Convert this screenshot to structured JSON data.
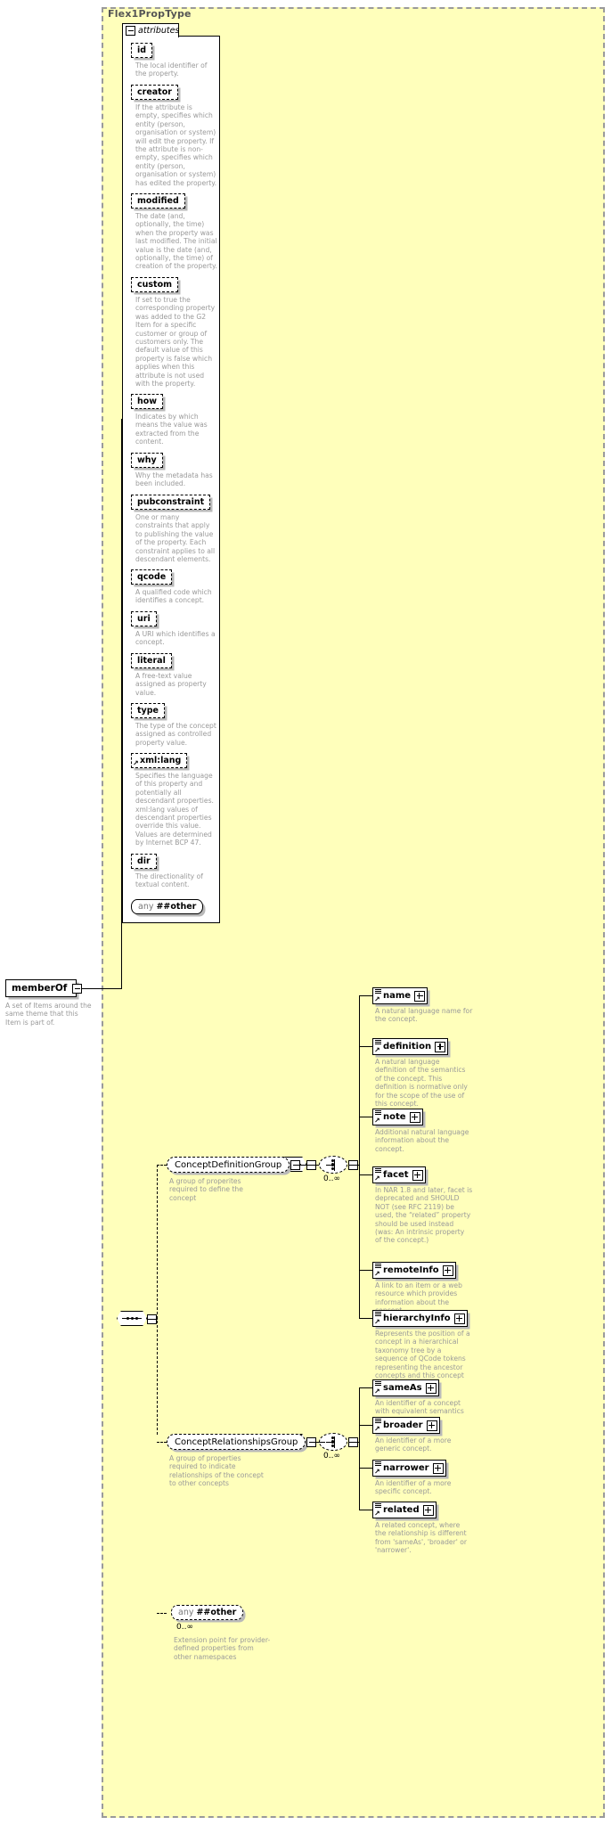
{
  "diagram": {
    "type_name": "Flex1PropType",
    "attributes_tab_label": "attributes",
    "root_element": {
      "name": "memberOf",
      "description": "A set of Items around the same theme that this Item is part of."
    },
    "colors": {
      "panel_background": "#ffffbb",
      "panel_border": "#9a9a9a",
      "description_text": "#9a9a9a",
      "box_shadow": "#b9b9b9",
      "element_text": "#000000"
    },
    "attributes": [
      {
        "name": "id",
        "description": "The local identifier of the property."
      },
      {
        "name": "creator",
        "description": "If the attribute is empty, specifies which entity (person, organisation or system) will edit the property. If the attribute is non-empty, specifies which entity (person, organisation or system) has edited the property."
      },
      {
        "name": "modified",
        "description": "The date (and, optionally, the time) when the property was last modified. The initial value is the date (and, optionally, the time) of creation of the property."
      },
      {
        "name": "custom",
        "description": "If set to true the corresponding property was added to the G2 Item for a specific customer or group of customers only. The default value of this property is false which applies when this attribute is not used with the property."
      },
      {
        "name": "how",
        "description": "Indicates by which means the value was extracted from the content."
      },
      {
        "name": "why",
        "description": "Why the metadata has been included."
      },
      {
        "name": "pubconstraint",
        "description": "One or many constraints that apply to publishing the value of the property. Each constraint applies to all descendant elements."
      },
      {
        "name": "qcode",
        "description": "A qualified code which identifies a concept."
      },
      {
        "name": "uri",
        "description": "A URI which identifies a concept."
      },
      {
        "name": "literal",
        "description": "A free-text value assigned as property value."
      },
      {
        "name": "type",
        "description": "The type of the concept assigned as controlled property value."
      },
      {
        "name": "xmllang",
        "display": "xml:lang",
        "description": "Specifies the language of this property and potentially all descendant properties. xml:lang values of descendant properties override this value. Values are determined by Internet BCP 47."
      },
      {
        "name": "dir",
        "description": "The directionality of textual content."
      }
    ],
    "attributes_any": {
      "any_label": "any",
      "namespace_label": "##other"
    },
    "groups": [
      {
        "id": "ConceptDefinitionGroup",
        "label": "ConceptDefinitionGroup",
        "description": "A group of properites required to define the concept",
        "cardinality": "0..∞",
        "elements": [
          {
            "name": "name",
            "description": "A natural language name for the concept."
          },
          {
            "name": "definition",
            "description": "A natural language definition of the semantics of the concept. This definition is normative only for the scope of the use of this concept."
          },
          {
            "name": "note",
            "description": "Additional natural language information about the concept."
          },
          {
            "name": "facet",
            "description": "In NAR 1.8 and later, facet is deprecated and SHOULD NOT (see RFC 2119) be used, the “related” property should be used instead (was: An intrinsic property of the concept.)"
          },
          {
            "name": "remoteInfo",
            "description": "A link to an item or a web resource which provides information about the concept"
          },
          {
            "name": "hierarchyInfo",
            "description": "Represents the position of a concept in a hierarchical taxonomy tree by a sequence of QCode tokens representing the ancestor concepts and this concept"
          }
        ]
      },
      {
        "id": "ConceptRelationshipsGroup",
        "label": "ConceptRelationshipsGroup",
        "description": "A group of properties required to indicate relationships of the concept to other concepts",
        "cardinality": "0..∞",
        "elements": [
          {
            "name": "sameAs",
            "description": "An identifier of a concept with equivalent semantics"
          },
          {
            "name": "broader",
            "description": "An identifier of a more generic concept."
          },
          {
            "name": "narrower",
            "description": "An identifier of a more specific concept."
          },
          {
            "name": "related",
            "description": "A related concept, where the relationship is different from 'sameAs', 'broader' or 'narrower'."
          }
        ]
      }
    ],
    "content_any": {
      "any_label": "any",
      "namespace_label": "##other",
      "cardinality": "0..∞",
      "description": "Extension point for provider-defined properties from other namespaces"
    },
    "icons": {
      "collapse": "minus-box-icon",
      "expand": "plus-box-icon",
      "sequence": "sequence-connector-icon",
      "choice": "choice-connector-icon",
      "element_type": "element-type-icon",
      "reference_arrow": "reference-arrow-icon"
    }
  }
}
